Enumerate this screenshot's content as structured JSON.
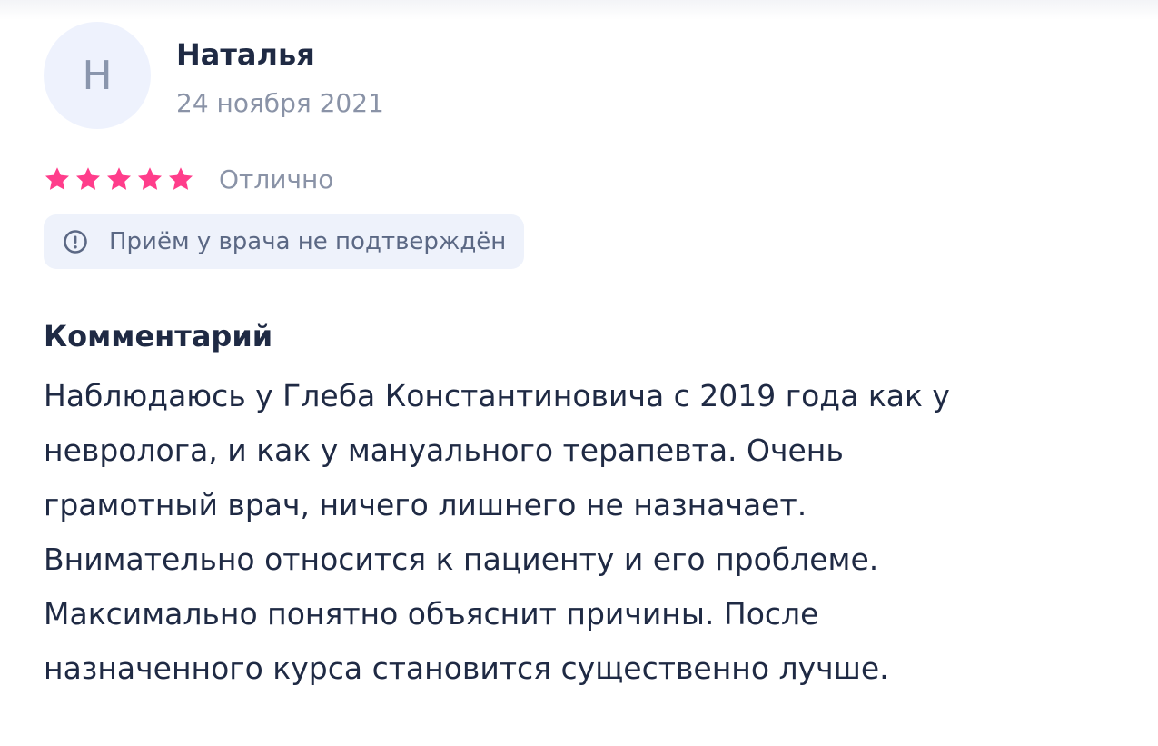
{
  "review": {
    "avatar_initial": "Н",
    "author_name": "Наталья",
    "date": "24 ноября 2021",
    "rating": {
      "stars": 5,
      "max_stars": 5,
      "label": "Отлично",
      "star_color": "#ff3d8b"
    },
    "verification_badge": {
      "icon": "exclamation-circle-icon",
      "text": "Приём у врача не подтверждён"
    },
    "comment_title": "Комментарий",
    "comment_text": "Наблюдаюсь у Глеба Константиновича с 2019 года как у\nневролога, и как у мануального терапевта. Очень\nграмотный врач, ничего лишнего не назначает.\nВнимательно относится к пациенту и его проблеме.\nМаксимально понятно объяснит причины. После\nназначенного курса становится существенно лучше."
  }
}
